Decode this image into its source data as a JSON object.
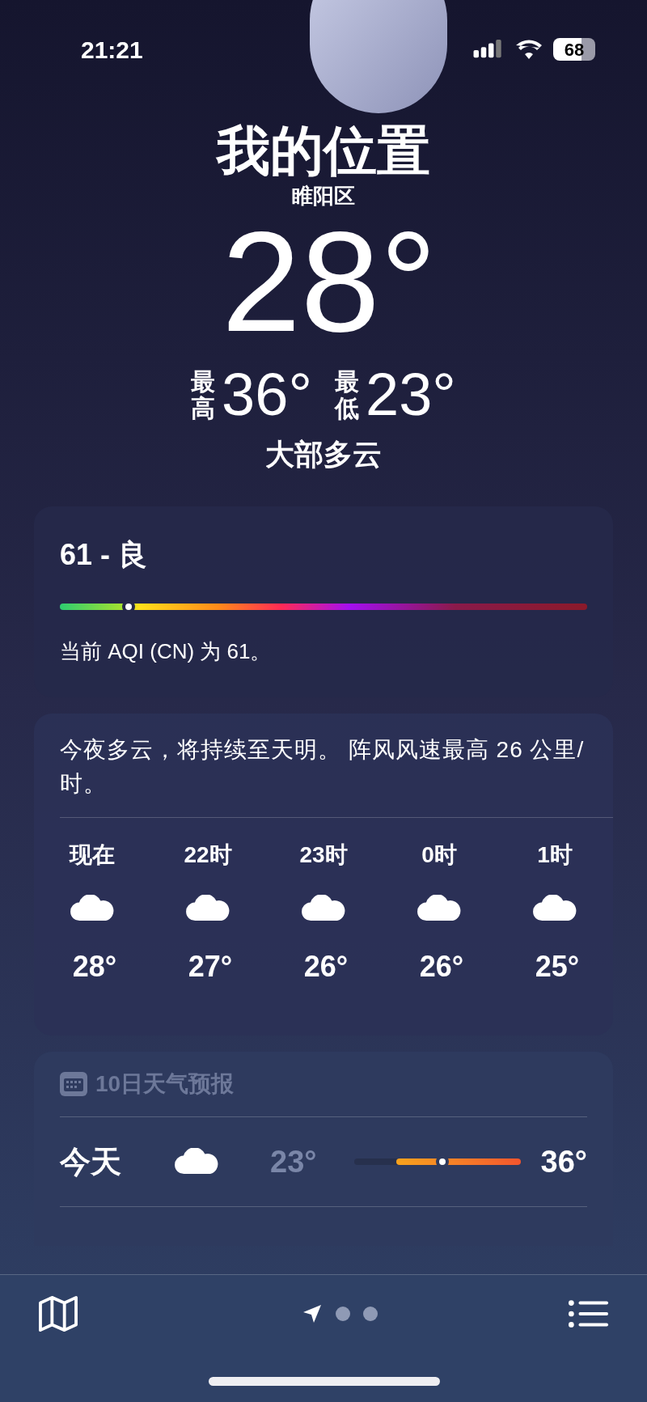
{
  "status_bar": {
    "time": "21:21",
    "battery": "68"
  },
  "location": {
    "title": "我的位置",
    "subtitle": "睢阳区",
    "temperature": "28°",
    "high_label": "最高",
    "high": "36°",
    "low_label": "最低",
    "low": "23°",
    "condition": "大部多云"
  },
  "aqi": {
    "heading": "61 - 良",
    "level": 0.13,
    "description": "当前 AQI (CN) 为 61。"
  },
  "hourly": {
    "summary": "今夜多云，将持续至天明。 阵风风速最高 26 公里/时。",
    "hours": [
      {
        "time": "现在",
        "temp": "28°"
      },
      {
        "time": "22时",
        "temp": "27°"
      },
      {
        "time": "23时",
        "temp": "26°"
      },
      {
        "time": "0时",
        "temp": "26°"
      },
      {
        "time": "1时",
        "temp": "25°"
      }
    ]
  },
  "forecast": {
    "heading": "10日天气预报",
    "days": [
      {
        "day": "今天",
        "low": "23°",
        "high": "36°",
        "level": 0.53
      }
    ]
  },
  "tab_bar": {
    "pages": [
      {
        "kind": "location",
        "selected": true
      },
      {
        "kind": "dot",
        "selected": false
      },
      {
        "kind": "dot",
        "selected": false
      }
    ]
  }
}
